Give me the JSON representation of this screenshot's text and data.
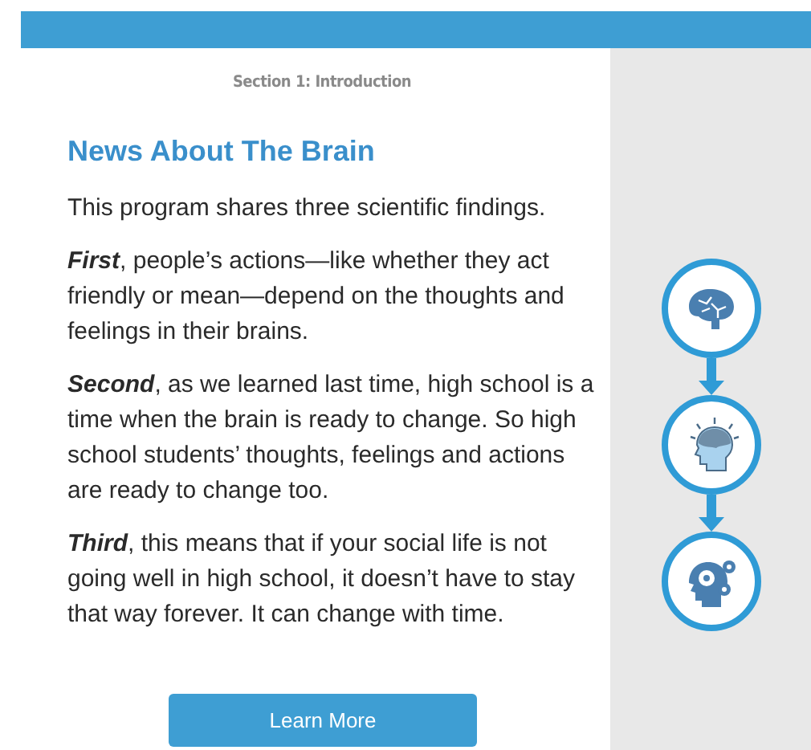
{
  "section_label": "Section 1: Introduction",
  "heading": "News About The Brain",
  "paragraphs": [
    "This program shares three scientific findings.",
    "**First**, people’s actions—like whether they act friendly or mean—depend on the thoughts and feelings in their brains.",
    "**Second**, as we learned last time, high school is a time when the brain is ready to change. So high school students’ thoughts, feelings and actions are ready to change too.",
    "**Third**, this means that if your social life is not going well in high school, it doesn’t have to stay that way forever. It can change with time."
  ],
  "button": "Learn More",
  "steps": [
    {
      "kind": "brain"
    },
    {
      "kind": "head"
    },
    {
      "kind": "gears"
    }
  ]
}
